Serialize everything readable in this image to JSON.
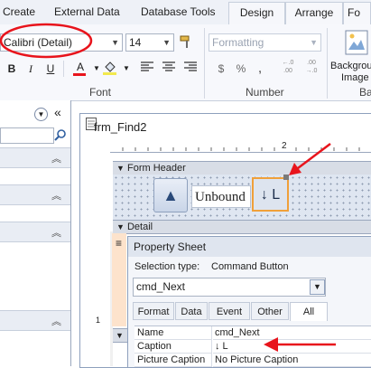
{
  "ribbon_tabs": [
    {
      "label": "Create"
    },
    {
      "label": "External Data"
    },
    {
      "label": "Database Tools"
    },
    {
      "label": "Design"
    },
    {
      "label": "Arrange"
    },
    {
      "label": "Fo"
    }
  ],
  "font_group": {
    "font_name": "Calibri (Detail)",
    "font_size": "14",
    "bold": "B",
    "italic": "I",
    "underline": "U",
    "font_color": "A",
    "label": "Font"
  },
  "number_group": {
    "format_placeholder": "Formatting",
    "currency": "$",
    "percent": "%",
    "comma": ",",
    "inc_decimals": "←.0 .00",
    "dec_decimals": ".00 →.0",
    "label": "Number"
  },
  "background_group": {
    "label_line1": "Backgrou",
    "label_line2": "Image",
    "group_initial": "Ba"
  },
  "nav_pane": {
    "collapse": "«"
  },
  "form_window": {
    "title": "frm_Find2",
    "ruler_mark": "2",
    "form_header_label": "Form Header",
    "detail_label": "Detail",
    "up_button": "▲",
    "unbound_text": "Unbound",
    "next_button_caption": "↓ L",
    "vruler_mark": "1"
  },
  "property_sheet": {
    "title": "Property Sheet",
    "selection_label": "Selection type:",
    "selection_value": "Command Button",
    "object_name": "cmd_Next",
    "tabs": [
      {
        "label": "Format"
      },
      {
        "label": "Data"
      },
      {
        "label": "Event"
      },
      {
        "label": "Other"
      },
      {
        "label": "All"
      }
    ],
    "selected_tab": "All",
    "rows": [
      {
        "name": "Name",
        "value": "cmd_Next"
      },
      {
        "name": "Caption",
        "value": "↓ L"
      },
      {
        "name": "Picture Caption",
        "value": "No Picture Caption"
      }
    ]
  },
  "colors": {
    "annotation_red": "#e8141c",
    "selection_orange": "#f0a03a"
  }
}
